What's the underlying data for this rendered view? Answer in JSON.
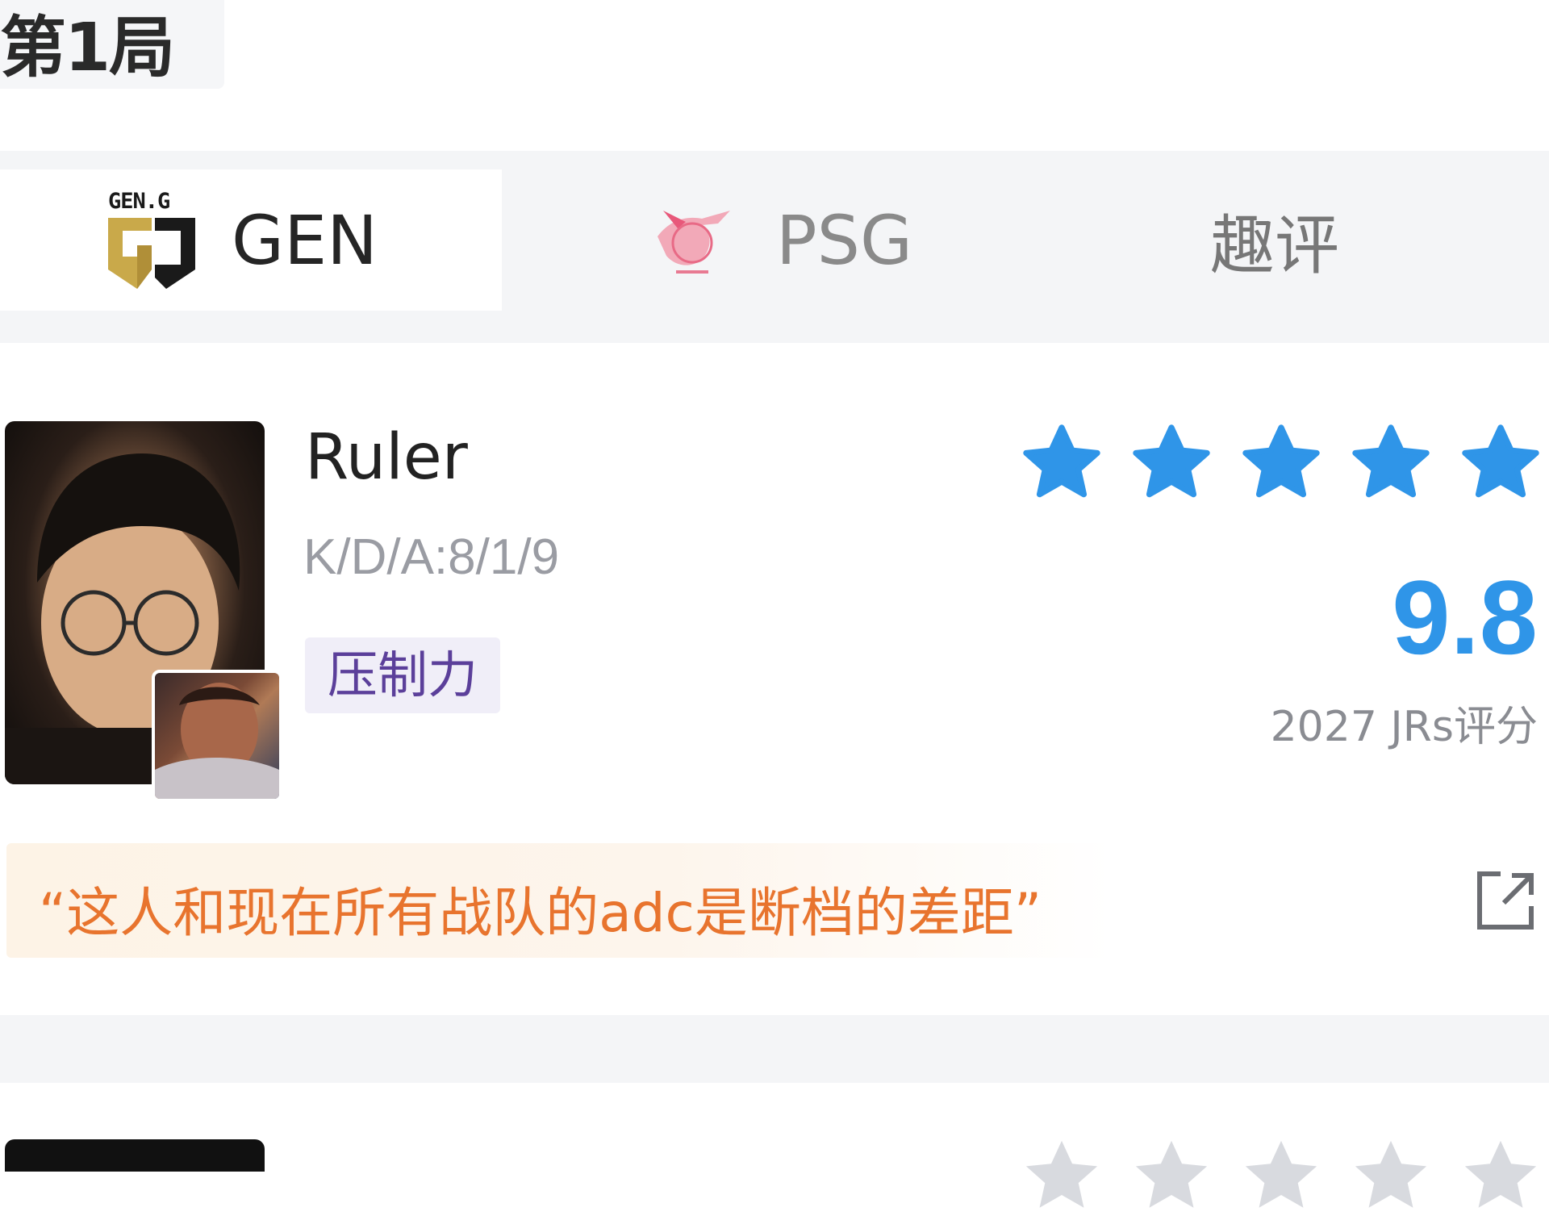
{
  "game": {
    "label": "第1局"
  },
  "tabs": [
    {
      "label": "GEN",
      "logo_text": "GEN.G"
    },
    {
      "label": "PSG"
    },
    {
      "label": "趣评"
    }
  ],
  "player": {
    "name": "Ruler",
    "kda": "K/D/A:8/1/9",
    "tag": "压制力",
    "rating_stars": 5,
    "score": "9.8",
    "rating_count": "2027 JRs评分",
    "quote": "“这人和现在所有战队的adc是断档的差距”"
  },
  "colors": {
    "accent_blue": "#2f95e8",
    "quote_orange": "#e8742e",
    "tag_purple": "#5b3f9a"
  },
  "icons": [
    "geng-logo",
    "psg-logo",
    "star-icon",
    "share-icon"
  ]
}
